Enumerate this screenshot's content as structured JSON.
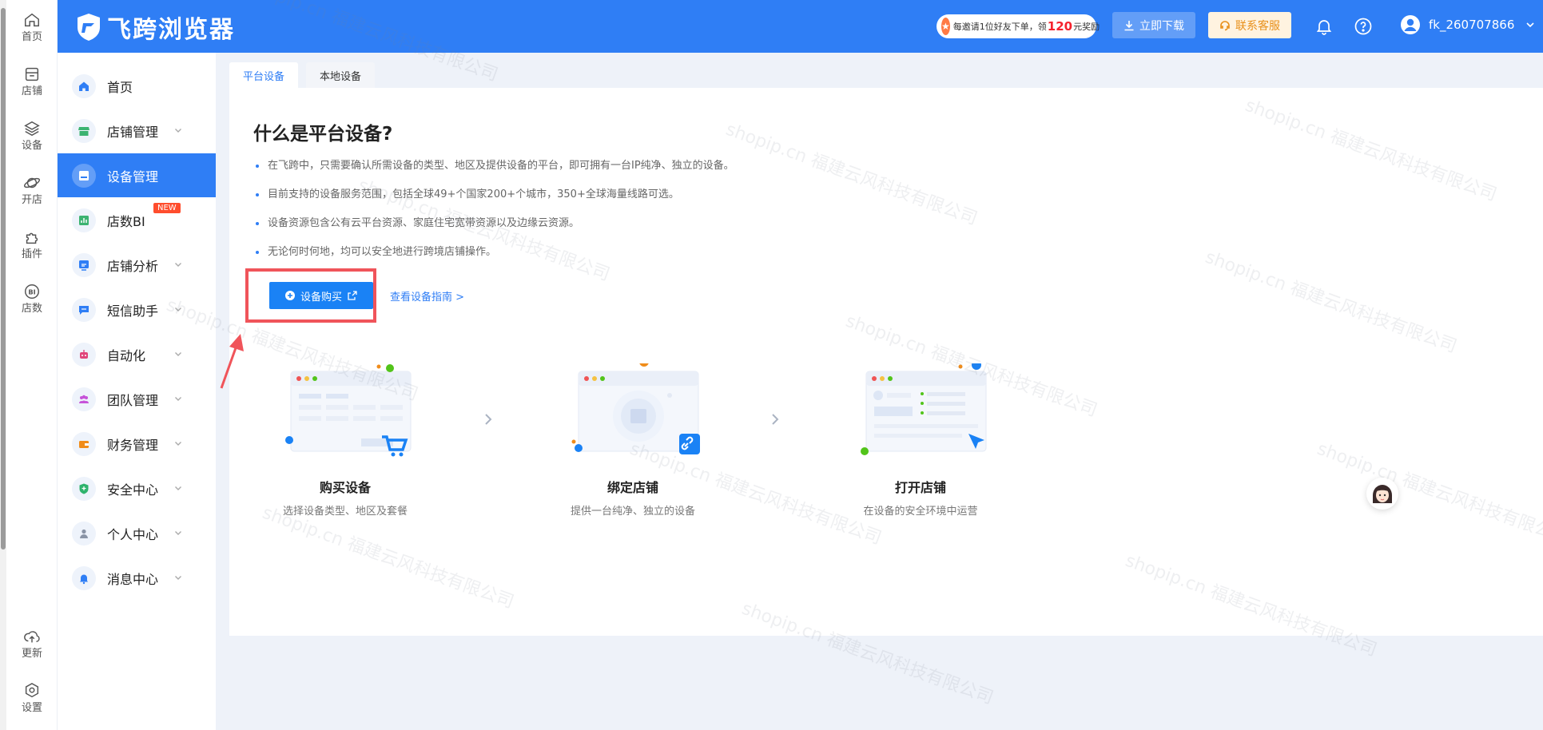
{
  "rail": {
    "items": [
      {
        "label": "首页",
        "icon": "home-icon"
      },
      {
        "label": "店铺",
        "icon": "store-icon"
      },
      {
        "label": "设备",
        "icon": "layers-icon"
      },
      {
        "label": "开店",
        "icon": "planet-icon"
      },
      {
        "label": "插件",
        "icon": "puzzle-icon"
      },
      {
        "label": "店数",
        "icon": "bi-icon",
        "icon_text": "BI"
      }
    ],
    "bottom": [
      {
        "label": "更新",
        "icon": "cloud-update-icon"
      },
      {
        "label": "设置",
        "icon": "settings-icon"
      }
    ]
  },
  "header": {
    "app_name": "飞跨浏览器",
    "promo_prefix": "每邀请1位好友下单，领",
    "promo_amount": "120",
    "promo_suffix": "元奖励",
    "download_label": "立即下载",
    "support_label": "联系客服",
    "username": "fk_260707866"
  },
  "sidenav": {
    "items": [
      {
        "label": "首页",
        "icon": "home-icon",
        "color": "#2f7ef5"
      },
      {
        "label": "店铺管理",
        "icon": "store-icon",
        "color": "#3cb371"
      },
      {
        "label": "设备管理",
        "icon": "device-icon",
        "color": "#ffffff",
        "active": true
      },
      {
        "label": "店数BI",
        "icon": "chart-icon",
        "color": "#3cb371",
        "badge": "NEW"
      },
      {
        "label": "店铺分析",
        "icon": "analysis-icon",
        "color": "#2f7ef5"
      },
      {
        "label": "短信助手",
        "icon": "sms-icon",
        "color": "#2f7ef5"
      },
      {
        "label": "自动化",
        "icon": "robot-icon",
        "color": "#e0457b"
      },
      {
        "label": "团队管理",
        "icon": "team-icon",
        "color": "#c653d9"
      },
      {
        "label": "财务管理",
        "icon": "wallet-icon",
        "color": "#f08c1a"
      },
      {
        "label": "安全中心",
        "icon": "shield-icon",
        "color": "#2fb36d"
      },
      {
        "label": "个人中心",
        "icon": "user-icon",
        "color": "#8a94a6"
      },
      {
        "label": "消息中心",
        "icon": "bell-icon",
        "color": "#2f7ef5"
      }
    ]
  },
  "tabs": [
    "平台设备",
    "本地设备"
  ],
  "content": {
    "title": "什么是平台设备?",
    "bullets": [
      "在飞跨中，只需要确认所需设备的类型、地区及提供设备的平台，即可拥有一台IP纯净、独立的设备。",
      "目前支持的设备服务范围，包括全球49+个国家200+个城市，350+全球海量线路可选。",
      "设备资源包含公有云平台资源、家庭住宅宽带资源以及边缘云资源。",
      "无论何时何地，均可以安全地进行跨境店铺操作。"
    ],
    "buy_label": "设备购买",
    "guide_label": "查看设备指南 >",
    "steps": [
      {
        "title": "购买设备",
        "desc": "选择设备类型、地区及套餐"
      },
      {
        "title": "绑定店铺",
        "desc": "提供一台纯净、独立的设备"
      },
      {
        "title": "打开店铺",
        "desc": "在设备的安全环境中运营"
      }
    ]
  },
  "watermark": "shopip.cn 福建云风科技有限公司",
  "colors": {
    "primary": "#2f7ef5",
    "highlight": "#f0545a",
    "badge": "#ff4d2d"
  }
}
